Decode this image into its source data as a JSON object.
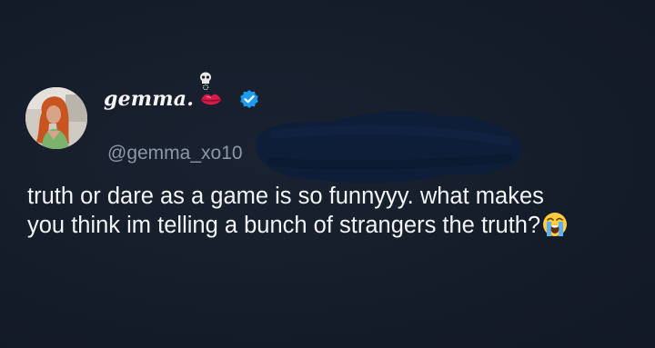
{
  "profile": {
    "display_name": "gemma.",
    "handle": "@gemma_xo10",
    "avatar_icon": "profile-photo",
    "name_emoji": "lips-icon",
    "status_icon": "skull-icon",
    "verified_icon": "verified-badge-icon"
  },
  "tweet": {
    "line1": "truth or dare as a game is so funnyyy. what makes",
    "line2": "you think im telling a bunch of strangers the truth?",
    "trailing_emoji": "loudly-crying-face-icon"
  },
  "colors": {
    "background": "#151c29",
    "text": "#f2f4f5",
    "handle": "#8b98a5",
    "verified": "#1d9bf0",
    "redaction": "#0e1e38"
  }
}
